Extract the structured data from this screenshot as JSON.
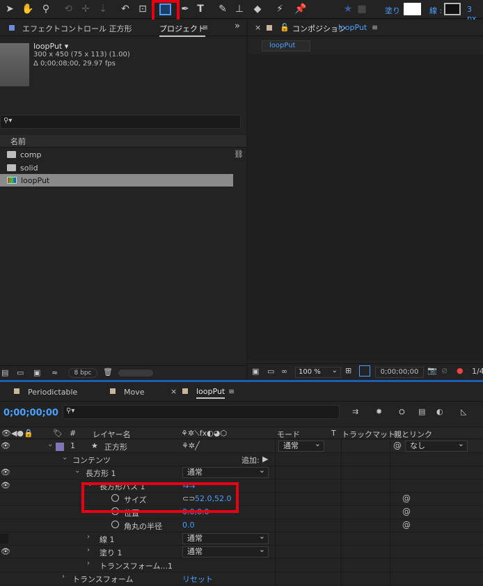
{
  "toolbar": {
    "tools": [
      "selection-tool",
      "hand-tool",
      "zoom-tool",
      "orbit-tool",
      "pan-tool",
      "dolly-tool",
      "rotate-tool",
      "pan-behind-tool",
      "rectangle-tool",
      "pen-tool",
      "text-tool",
      "brush-tool",
      "clone-stamp-tool",
      "eraser-tool",
      "roto-brush-tool",
      "puppet-pin-tool"
    ],
    "fill_label": "塗り :",
    "stroke_label": "線 :",
    "stroke_width": "3 px"
  },
  "project_panel": {
    "tab_effect_controls": "エフェクトコントロール 正方形",
    "tab_project": "プロジェクト",
    "tab_menu": "≡",
    "comp_name": "loopPut ▾",
    "comp_dims": "300 x 450  (75 x 113) (1.00)",
    "comp_duration": "Δ 0;00;08;00, 29.97 fps",
    "search_placeholder": "",
    "col_name": "名前",
    "items": [
      {
        "label": "comp"
      },
      {
        "label": "solid"
      },
      {
        "label": "loopPut"
      }
    ],
    "bpc": "8 bpc"
  },
  "comp_panel": {
    "close": "×",
    "tab_prefix": "コンポジション",
    "tab_comp": "loopPut",
    "tab_menu": "≡",
    "chip": "loopPut",
    "zoom": "100 %",
    "timecode": "0;00;00;00",
    "extra": "1/4"
  },
  "timeline": {
    "tabs": [
      {
        "label": "Periodictable"
      },
      {
        "label": "Move"
      },
      {
        "label": "loopPut"
      }
    ],
    "tab_close": "×",
    "tab_menu": "≡",
    "current_time": "0;00;00;00",
    "headers": {
      "num": "#",
      "layer_name": "レイヤー名",
      "mode": "モード",
      "t": "T",
      "track_matte": "トラックマット",
      "parent": "親とリンク"
    },
    "rows": {
      "layer_num": "1",
      "layer_name": "正方形",
      "layer_mode": "通常",
      "layer_parent": "なし",
      "contents": "コンテンツ",
      "add": "追加:",
      "rect1": "長方形 1",
      "rect1_mode": "通常",
      "rect_path": "長方形パス 1",
      "size_label": "サイズ",
      "size_value": "52.0,52.0",
      "position_label": "位置",
      "position_value": "0.0,0.0",
      "roundness_label": "角丸の半径",
      "roundness_value": "0.0",
      "stroke1": "線 1",
      "stroke1_mode": "通常",
      "fill1": "塗り 1",
      "fill1_mode": "通常",
      "transform_rect": "トランスフォーム...1",
      "transform": "トランスフォーム",
      "reset": "リセット"
    }
  },
  "colors": {
    "accent_blue": "#4aa0ff",
    "highlight_red": "#e60012",
    "label_swatch": "#7f76b8",
    "panel_bg": "#232323"
  }
}
